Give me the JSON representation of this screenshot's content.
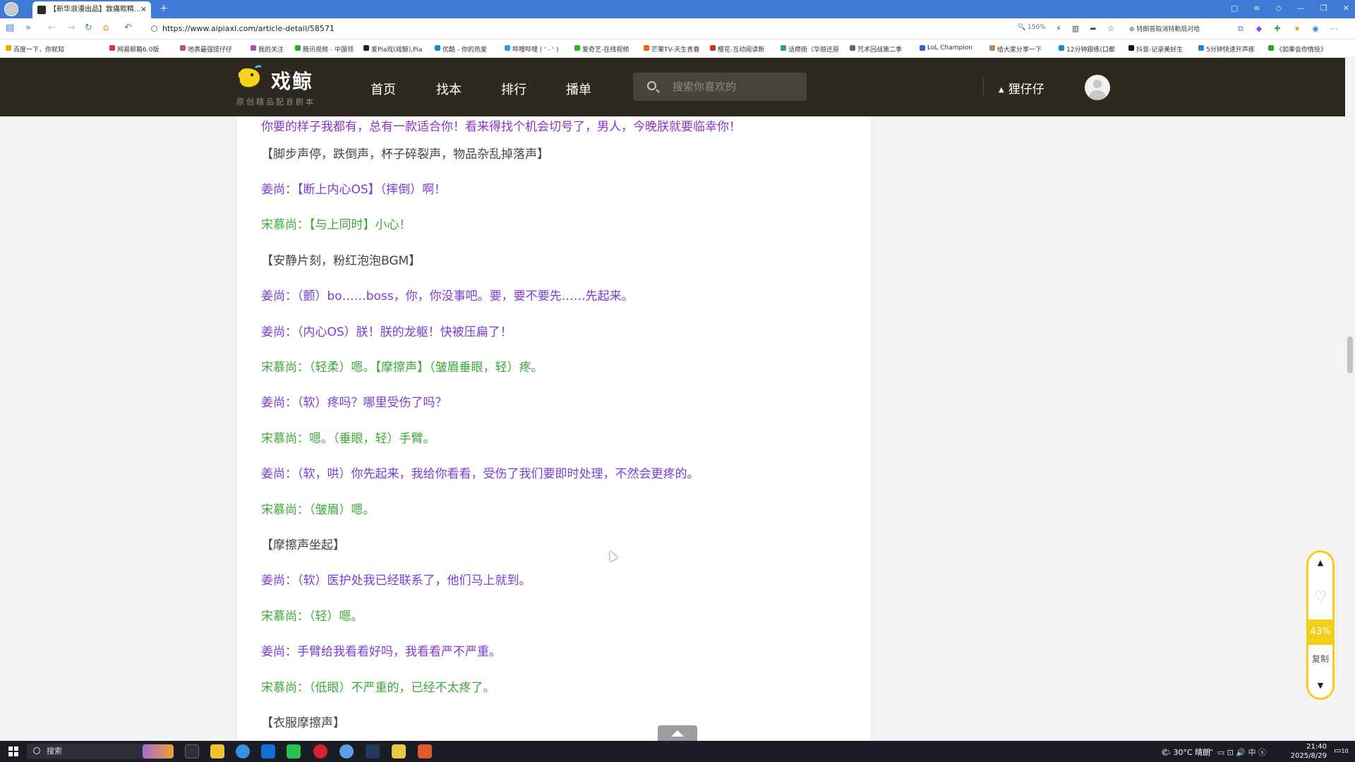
{
  "browser": {
    "tab_title": "【新华浪漫出品】致痛欺精...",
    "url": "https://www.aipiaxi.com/article-detail/58571",
    "zoom": "150%",
    "news_text": "特朗普取消特勤局对哈",
    "bookmarks": [
      "百度一下，你就知",
      "网易邮箱6.0版",
      "地表最强提仔仔",
      "我的关注",
      "腾讯视频 - 中国领",
      "爱Pia戏(戏鲸),Pia",
      "优酷 - 你的热爱",
      "哔哩哔哩 ( ' - ' )",
      "爱奇艺-在线视频",
      "芒果TV-天生青春",
      "樱花-互动阅读新",
      "话痨街（华丽还原",
      "咒术回战第二季",
      "LoL Champion",
      "给大家分享一下",
      "12分钟跟练(口都",
      "抖音-记录美好生",
      "5分钟快速开声练",
      "《如果会你情投》"
    ]
  },
  "site": {
    "logo_text": "戏鲸",
    "logo_sub": "原创精品配音剧本",
    "nav": [
      "首页",
      "找本",
      "排行",
      "播单"
    ],
    "search_placeholder": "搜索你喜欢的",
    "user_name": "狸仔仔"
  },
  "article": {
    "lines": [
      {
        "text": "你要的样子我都有，总有一款适合你！看来得找个机会切号了，男人，今晚朕就要临幸你！",
        "color": "purple"
      },
      {
        "text": "【脚步声停，跌倒声，杯子碎裂声，物品杂乱掉落声】",
        "color": "gray"
      },
      {
        "text": "姜尚：【断上内心OS】（摔倒）啊！",
        "color": "blue"
      },
      {
        "text": "宋慕尚：【与上同时】小心！",
        "color": "green"
      },
      {
        "text": "【安静片刻，粉红泡泡BGM】",
        "color": "gray"
      },
      {
        "text": "姜尚：（颤）bo……boss，你，你没事吧。要，要不要先……先起来。",
        "color": "blue"
      },
      {
        "text": "姜尚：（内心OS）朕！朕的龙躯！快被压扁了！",
        "color": "blue"
      },
      {
        "text": "宋慕尚：（轻柔）嗯。【摩擦声】（皱眉垂眼，轻）疼。",
        "color": "green"
      },
      {
        "text": "姜尚：（软）疼吗？哪里受伤了吗？",
        "color": "blue"
      },
      {
        "text": "宋慕尚：嗯。（垂眼，轻）手臂。",
        "color": "green"
      },
      {
        "text": "姜尚：（软，哄）你先起来，我给你看看，受伤了我们要即时处理，不然会更疼的。",
        "color": "blue"
      },
      {
        "text": "宋慕尚：（皱眉）嗯。",
        "color": "green"
      },
      {
        "text": "【摩擦声坐起】",
        "color": "gray"
      },
      {
        "text": "姜尚：（软）医护处我已经联系了，他们马上就到。",
        "color": "blue"
      },
      {
        "text": "宋慕尚：（轻）嗯。",
        "color": "green"
      },
      {
        "text": "姜尚：手臂给我看看好吗，我看看严不严重。",
        "color": "blue"
      },
      {
        "text": "宋慕尚：（低眼）不严重的，已经不太疼了。",
        "color": "green"
      },
      {
        "text": "【衣服摩擦声】",
        "color": "gray"
      }
    ]
  },
  "float_panel": {
    "progress": "43%",
    "copy_label": "复制"
  },
  "taskbar": {
    "search_label": "搜索",
    "weather": "30°C 晴朗",
    "ime": "中",
    "time": "21:40",
    "date": "2025/8/29",
    "notification_count": "10"
  },
  "colors": {
    "header_bg": "#2c2a1f",
    "accent_yellow": "#f3cf1c",
    "purple_text": "#8a32c8",
    "green_text": "#3da83a"
  }
}
